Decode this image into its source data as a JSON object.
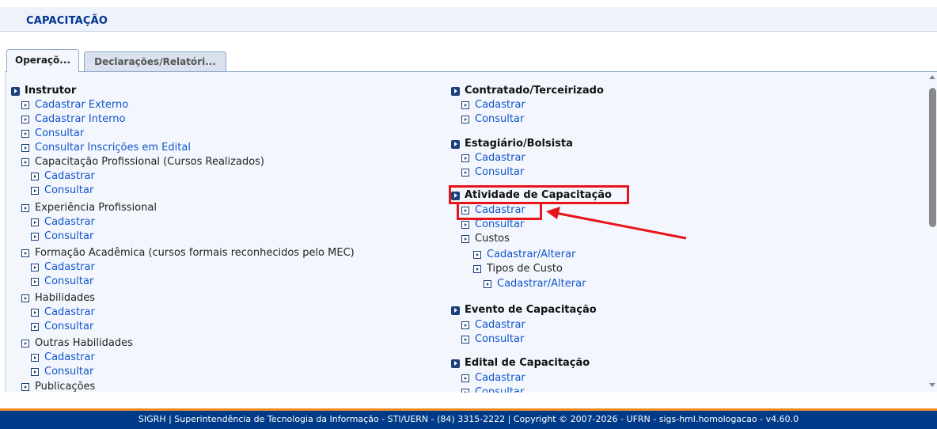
{
  "page": {
    "title": "Capacitação"
  },
  "tabs": [
    {
      "label": "Operaçõ...",
      "active": true
    },
    {
      "label": "Declarações/Relatóri...",
      "active": false
    }
  ],
  "left_menu": {
    "instrutor": {
      "title": "Instrutor",
      "cadastrar_externo": "Cadastrar Externo",
      "cadastrar_interno": "Cadastrar Interno",
      "consultar": "Consultar",
      "consultar_inscricoes": "Consultar Inscrições em Edital",
      "capacitacao_profissional": {
        "label": "Capacitação Profissional (Cursos Realizados)",
        "cadastrar": "Cadastrar",
        "consultar": "Consultar"
      },
      "experiencia_profissional": {
        "label": "Experiência Profissional",
        "cadastrar": "Cadastrar",
        "consultar": "Consultar"
      },
      "formacao_academica": {
        "label": "Formação Acadêmica (cursos formais reconhecidos pelo MEC)",
        "cadastrar": "Cadastrar",
        "consultar": "Consultar"
      },
      "habilidades": {
        "label": "Habilidades",
        "cadastrar": "Cadastrar",
        "consultar": "Consultar"
      },
      "outras_habilidades": {
        "label": "Outras Habilidades",
        "cadastrar": "Cadastrar",
        "consultar": "Consultar"
      },
      "publicacoes": {
        "label": "Publicações"
      }
    }
  },
  "right_menu": {
    "contratado": {
      "title": "Contratado/Terceirizado",
      "cadastrar": "Cadastrar",
      "consultar": "Consultar"
    },
    "estagiario": {
      "title": "Estagiário/Bolsista",
      "cadastrar": "Cadastrar",
      "consultar": "Consultar"
    },
    "atividade": {
      "title": "Atividade de Capacitação",
      "cadastrar": "Cadastrar",
      "consultar": "Consultar",
      "custos": {
        "label": "Custos",
        "cadastrar_alterar": "Cadastrar/Alterar"
      },
      "tipos_de_custo": {
        "label": "Tipos de Custo",
        "cadastrar_alterar": "Cadastrar/Alterar"
      }
    },
    "evento": {
      "title": "Evento de Capacitação",
      "cadastrar": "Cadastrar",
      "consultar": "Consultar"
    },
    "edital": {
      "title": "Edital de Capacitação",
      "cadastrar": "Cadastrar",
      "consultar": "Consultar"
    }
  },
  "annotation": {
    "color": "#e8141c"
  },
  "footer": {
    "text": "SIGRH | Superintendência de Tecnologia da Informação - STI/UERN - (84) 3315-2222 | Copyright © 2007-2026 - UFRN - sigs-hml.homologacao - v4.60.0"
  },
  "colors": {
    "link": "#1155cc",
    "title": "#003390",
    "footer_bg": "#003b89",
    "footer_border": "#f08a24",
    "panel_bg": "#f3f7fd"
  }
}
